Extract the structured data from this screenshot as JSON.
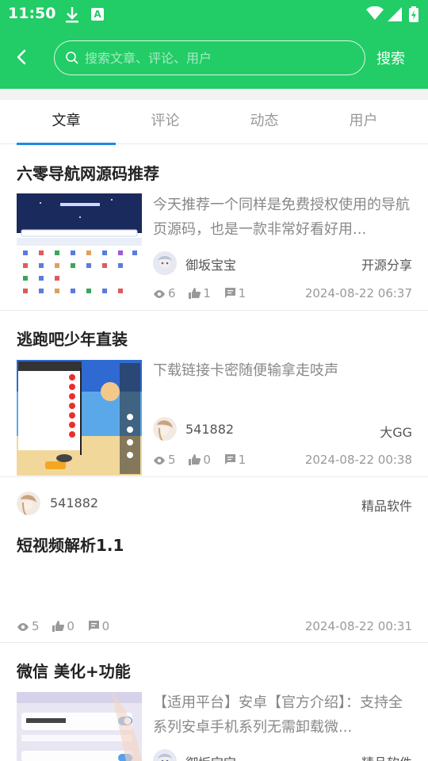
{
  "status_bar": {
    "time": "11:50"
  },
  "header": {
    "search_placeholder": "搜索文章、评论、用户",
    "search_button": "搜索"
  },
  "tabs": [
    {
      "label": "文章",
      "active": true
    },
    {
      "label": "评论",
      "active": false
    },
    {
      "label": "动态",
      "active": false
    },
    {
      "label": "用户",
      "active": false
    }
  ],
  "posts": [
    {
      "title": "六零导航网源码推荐",
      "excerpt": "今天推荐一个同样是免费授权使用的导航页源码，也是一款非常好看好用...",
      "author": "御坂宝宝",
      "category": "开源分享",
      "views": "6",
      "likes": "1",
      "comments": "1",
      "date": "2024-08-22 06:37"
    },
    {
      "title": "逃跑吧少年直装",
      "excerpt": "下载链接卡密随便输拿走吱声",
      "author": "541882",
      "category": "大GG",
      "views": "5",
      "likes": "0",
      "comments": "1",
      "date": "2024-08-22 00:38"
    },
    {
      "title": "短视频解析1.1",
      "author": "541882",
      "category": "精品软件",
      "views": "5",
      "likes": "0",
      "comments": "0",
      "date": "2024-08-22 00:31"
    },
    {
      "title": "微信 美化+功能",
      "excerpt": "【适用平台】安卓【官方介绍】：支持全系列安卓手机系列无需卸载微...",
      "author": "御坂宝宝",
      "category": "精品软件"
    }
  ],
  "colors": {
    "brand": "#22cc66",
    "tab_indicator": "#1e88e5"
  }
}
